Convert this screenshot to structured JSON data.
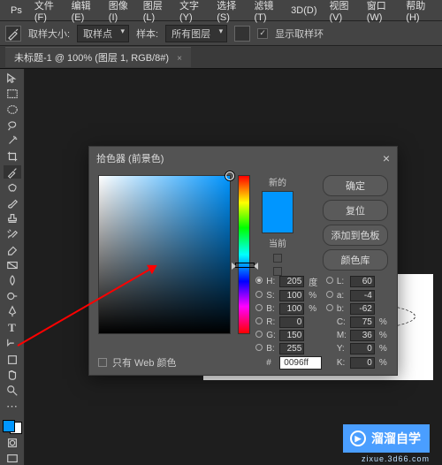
{
  "menubar": {
    "items": [
      {
        "label": "文件(F)"
      },
      {
        "label": "编辑(E)"
      },
      {
        "label": "图像(I)"
      },
      {
        "label": "图层(L)"
      },
      {
        "label": "文字(Y)"
      },
      {
        "label": "选择(S)"
      },
      {
        "label": "滤镜(T)"
      },
      {
        "label": "3D(D)"
      },
      {
        "label": "视图(V)"
      },
      {
        "label": "窗口(W)"
      },
      {
        "label": "帮助(H)"
      }
    ]
  },
  "optionsbar": {
    "sample_label": "取样大小:",
    "sample_value": "取样点",
    "sample2_label": "样本:",
    "sample2_value": "所有图层",
    "ring_label": "显示取样环"
  },
  "tabbar": {
    "tab": "未标题-1 @ 100% (图层 1, RGB/8#)"
  },
  "toolbar": {
    "tools": [
      "move",
      "rect-marquee",
      "ellipse-marquee",
      "lasso",
      "wand",
      "crop",
      "eyedropper",
      "healing",
      "brush",
      "stamp",
      "history",
      "eraser",
      "gradient",
      "blur",
      "dodge",
      "pen",
      "type",
      "path",
      "shape",
      "hand",
      "zoom"
    ]
  },
  "colors": {
    "foreground": "#0096ff",
    "background": "#ffffff"
  },
  "picker": {
    "title": "拾色器 (前景色)",
    "new_label": "新的",
    "current_label": "当前",
    "buttons": {
      "ok": "确定",
      "reset": "复位",
      "add": "添加到色板",
      "lib": "颜色库"
    },
    "web_label": "只有 Web 颜色",
    "hex": "0096ff ",
    "fields": {
      "H": {
        "v": "205",
        "u": "度"
      },
      "S": {
        "v": "100",
        "u": "%"
      },
      "B": {
        "v": "100",
        "u": "%"
      },
      "R": {
        "v": "0"
      },
      "G": {
        "v": "150"
      },
      "Bb": {
        "v": "255"
      },
      "L": {
        "v": "60"
      },
      "a": {
        "v": "-4"
      },
      "b": {
        "v": "-62"
      },
      "C": {
        "v": "75",
        "u": "%"
      },
      "M": {
        "v": "36",
        "u": "%"
      },
      "Y": {
        "v": "0",
        "u": "%"
      },
      "K": {
        "v": "0",
        "u": "%"
      }
    }
  },
  "watermark": {
    "text": "溜溜自学",
    "url": "zixue.3d66.com"
  }
}
